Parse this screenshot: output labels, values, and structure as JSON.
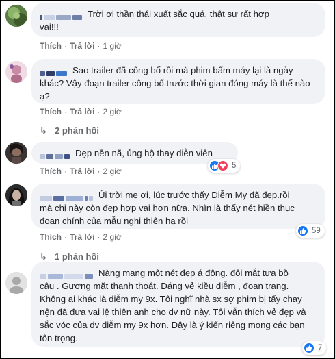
{
  "labels": {
    "like": "Thích",
    "reply": "Trả lời",
    "separator": "·"
  },
  "comments": [
    {
      "text_lines": [
        "Trời ơi thần thái xuất sắc quá, thật sự rất hợp",
        "vai!!!"
      ],
      "time": "1 giờ"
    },
    {
      "text_lines": [
        "Sao trailer đã công bố rồi mà phim bấm máy lại là ngày",
        "khác? Vậy đoạn trailer công bố trước thời gian đóng máy là thế nào",
        "ạ?"
      ],
      "time": "2 giờ",
      "replies": "2 phản hồi"
    },
    {
      "text_lines": [
        "Đẹp nền nã, ủng hộ thay diễn viên"
      ],
      "time": "2 giờ",
      "reaction_count": "5",
      "reaction_icons": [
        "like-icon",
        "love-icon"
      ]
    },
    {
      "text_lines": [
        "Úi trời mẹ ơi, lúc trước thấy Diễm My đã đẹp.rồi",
        "mà chị này còn đẹp hợp vai hơn nữa. Nhìn là thấy nét hiền thục",
        "đoan chính của mẫu nghi thiên hạ rồi"
      ],
      "time": "2 giờ",
      "reaction_count": "59",
      "reaction_icons": [
        "like-icon"
      ],
      "replies": "1 phản hồi"
    },
    {
      "text_lines": [
        "Nàng mang một nét đẹp á đông. đôi mắt tựa bồ",
        "câu . Gương mặt thanh thoát. Dáng vẻ kiều diễm , đoan trang.",
        "Không ai khác là diễm my 9x. Tôi nghĩ nhà sx sợ phim bị tẩy chay",
        "nện đã đưa vai lệ thiên anh cho dv nữ này. Tôi vẫn thích vẻ đẹp và",
        "sắc vóc của dv diễm my 9x hơn. Đây là ý kiến riêng mong các bạn",
        "tôn trọng."
      ],
      "reaction_count": "7",
      "reaction_icons": [
        "like-icon"
      ]
    }
  ],
  "colors": {
    "bubble": "#f0f2f5",
    "meta_text": "#65676b",
    "like_blue": "#1877f2",
    "love_red": "#f33e58",
    "border": "#000000"
  }
}
